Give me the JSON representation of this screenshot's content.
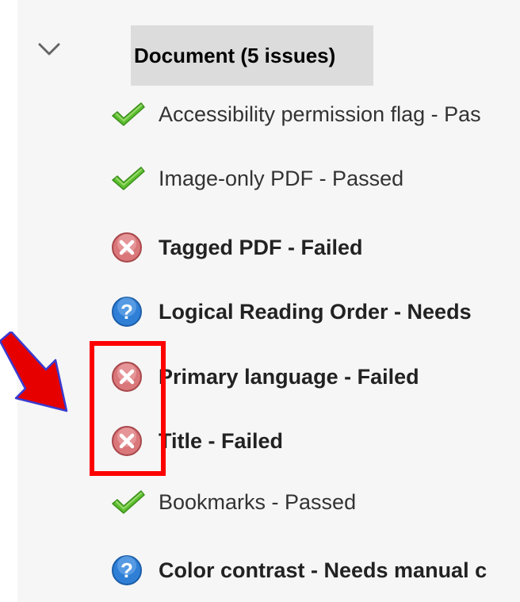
{
  "section": {
    "title": "Document (5 issues)",
    "expanded_icon": "chevron-down-icon"
  },
  "rows": [
    {
      "label": "Accessibility permission flag - Pas",
      "status": "passed",
      "icon": "checkmark-icon"
    },
    {
      "label": "Image-only PDF - Passed",
      "status": "passed",
      "icon": "checkmark-icon"
    },
    {
      "label": "Tagged PDF - Failed",
      "status": "failed",
      "icon": "fail-x-icon"
    },
    {
      "label": "Logical Reading Order - Needs",
      "status": "manual",
      "icon": "question-icon"
    },
    {
      "label": "Primary language - Failed",
      "status": "failed",
      "icon": "fail-x-icon"
    },
    {
      "label": "Title - Failed",
      "status": "failed",
      "icon": "fail-x-icon"
    },
    {
      "label": "Bookmarks - Passed",
      "status": "passed",
      "icon": "checkmark-icon"
    },
    {
      "label": "Color contrast - Needs manual c",
      "status": "manual",
      "icon": "question-icon"
    }
  ],
  "colors": {
    "passed": "#4caf2a",
    "failed": "#d9777a",
    "manual": "#2f7fd6",
    "annotation": "#ff0000"
  }
}
